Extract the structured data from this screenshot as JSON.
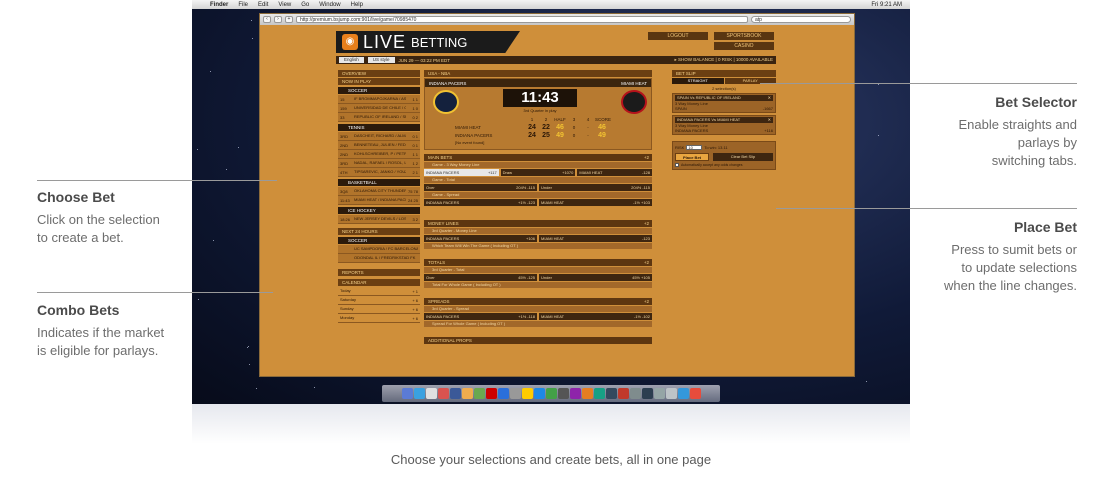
{
  "callouts": {
    "choose_bet": {
      "title": "Choose Bet",
      "line1": "Click on the selection",
      "line2": "to create a bet."
    },
    "combo_bets": {
      "title": "Combo Bets",
      "line1": "Indicates if the market",
      "line2": "is eligible for parlays."
    },
    "bet_selector": {
      "title": "Bet Selector",
      "line1": "Enable straights and",
      "line2": "parlays by",
      "line3": "switching tabs."
    },
    "place_bet": {
      "title": "Place Bet",
      "line1": "Press to sumit bets or",
      "line2": "to update selections",
      "line3": "when the line changes."
    }
  },
  "caption": "Choose your selections and create bets, all in one page",
  "menubar": {
    "app": "Finder",
    "items": [
      "File",
      "Edit",
      "View",
      "Go",
      "Window",
      "Help"
    ],
    "clock": "Fri 9:21 AM"
  },
  "browser": {
    "url": "http://premium.bsjump.com:901/live/game/70985470",
    "search": "atp"
  },
  "site": {
    "logo_live": "LIVE",
    "logo_betting": "BETTING",
    "buttons": {
      "logout": "LOGOUT",
      "sportsbook": "SPORTSBOOK",
      "casino": "CASINO"
    },
    "toolbar": {
      "language": "English",
      "odds": "US style",
      "date": "JUN 29 — 03:22 PM EDT",
      "balance": "▸ SHOW BALANCE | 0 RISK | 10000 AVAILABLE"
    }
  },
  "left": {
    "overview": "OVERVIEW",
    "now_in_play": "NOW IN PLAY",
    "soccer": "SOCCER",
    "soccer_events": [
      {
        "time": "15",
        "teams": "IF BROMMAPOJKARNA / ASSYRISKA FF",
        "s1": "1",
        "s2": "1"
      },
      {
        "time": "159",
        "teams": "UNIVERSIDAD DE CHILE / O'HIGGINS",
        "s1": "1",
        "s2": "0"
      },
      {
        "time": "33",
        "teams": "REPUBLIC OF IRELAND / SPAIN",
        "s1": "0",
        "s2": "2"
      }
    ],
    "tennis": "TENNIS",
    "tennis_events": [
      {
        "time": "3RD",
        "teams": "DASCHEIT, RICHARD / ALMAGRO, NICOLAS",
        "s1": "0",
        "s2": "1"
      },
      {
        "time": "2ND",
        "teams": "BENNETEAU, JULIEN / FEDERER, ROGER",
        "s1": "0",
        "s2": "1"
      },
      {
        "time": "2ND",
        "teams": "KOHLSCHREIBER, P / PETROVA, NADIA",
        "s1": "1",
        "s2": "1"
      },
      {
        "time": "3RD",
        "teams": "NADAL, RAFAEL / ROSOL, LUKAS",
        "s1": "1",
        "s2": "2"
      },
      {
        "time": "4TH",
        "teams": "TIPSAREVIC, JANKO / YOUZHNY, MIKHAIL",
        "s1": "2",
        "s2": "1"
      }
    ],
    "basketball": "BASKETBALL",
    "basketball_events": [
      {
        "time": "3Q8",
        "teams": "OKLAHOMA CITY THUNDER / MIAMI HEAT",
        "s1": "75",
        "s2": "78"
      },
      {
        "time": "11:43",
        "teams": "MIAMI HEAT / INDIANA PACERS",
        "s1": "24",
        "s2": "25"
      }
    ],
    "ice_hockey": "ICE HOCKEY",
    "hockey_events": [
      {
        "time": "18:26",
        "teams": "NEW JERSEY DEVILS / LOS ANGELES KINGS",
        "s1": "3",
        "s2": "2"
      }
    ],
    "next_24": "NEXT 24 HOURS",
    "soccer2": "SOCCER",
    "next_events": [
      {
        "time": "",
        "teams": "UC SAMPDORIA / FC BARCELONA 1918"
      },
      {
        "time": "",
        "teams": "ODONDAL IL / FREDRIKSTAD FK"
      }
    ],
    "reports": "REPORTS",
    "calendar": "CALENDAR",
    "calendar_days": [
      {
        "day": "Today",
        "count": "+ 1"
      },
      {
        "day": "Saturday",
        "count": "+ 6"
      },
      {
        "day": "Sunday",
        "count": "+ 6"
      },
      {
        "day": "Monday",
        "count": "+ 6"
      }
    ]
  },
  "game": {
    "league": "USA - NBA",
    "home": "INDIANA PACERS",
    "away": "MIAMI HEAT",
    "clock": "11:43",
    "period": "3rd Quarter in play",
    "headers": [
      "1",
      "2",
      "HALF",
      "3",
      "4",
      "SCORE"
    ],
    "rows": [
      {
        "team": "MIAMI HEAT",
        "q1": "24",
        "q2": "22",
        "half": "46",
        "q3": "0",
        "q4": "-",
        "score": "46"
      },
      {
        "team": "INDIANA PACERS",
        "q1": "24",
        "q2": "25",
        "half": "49",
        "q3": "0",
        "q4": "-",
        "score": "49"
      }
    ],
    "no_event": "[No event found]"
  },
  "markets": {
    "main_bets": "MAIN BETS",
    "game_money": "Game - 3 Way Money Line",
    "money_sel": [
      {
        "name": "INDIANA PACERS",
        "odds": "+117"
      },
      {
        "name": "Draw",
        "odds": "+1070"
      },
      {
        "name": "MIAMI HEAT",
        "odds": "-128"
      }
    ],
    "game_total": "Game - Total",
    "total_sel": [
      {
        "name": "Over",
        "odds": "204½ -115"
      },
      {
        "name": "Under",
        "odds": "204½ -115"
      }
    ],
    "game_spread": "Game - Spread",
    "spread_sel": [
      {
        "name": "INDIANA PACERS",
        "odds": "+1½ -123"
      },
      {
        "name": "MIAMI HEAT",
        "odds": "-1½ +103"
      }
    ],
    "money_lines": "MONEY LINES",
    "q3_money": "3rd Quarter - Money Line",
    "q3_money_sel": [
      {
        "name": "INDIANA PACERS",
        "odds": "+106"
      },
      {
        "name": "MIAMI HEAT",
        "odds": "-123"
      }
    ],
    "which_team": "Which Team Will Win The Game ( Including OT )",
    "totals": "TOTALS",
    "q3_total": "3rd Quarter - Total",
    "q3_total_sel": [
      {
        "name": "Over",
        "odds": "45½ -125"
      },
      {
        "name": "Under",
        "odds": "45½ +105"
      }
    ],
    "total_whole": "Total For Whole Game ( Including OT )",
    "spreads": "SPREADS",
    "q3_spread": "3rd Quarter - Spread",
    "q3_spread_sel": [
      {
        "name": "INDIANA PACERS",
        "odds": "+1½ -118"
      },
      {
        "name": "MIAMI HEAT",
        "odds": "-1½ -102"
      }
    ],
    "spread_whole": "Spread For Whole Game ( Including OT )",
    "additional": "ADDITIONAL PROPS"
  },
  "slip": {
    "title": "BET SLIP",
    "tab_straight": "STRAIGHT",
    "tab_parlay": "PARLAY",
    "count": "2 selection(s)",
    "items": [
      {
        "match": "SPAIN Vs REPUBLIC OF IRELAND",
        "market": "3 Way Money Line",
        "pick": "SPAIN",
        "odds": "-1667"
      },
      {
        "match": "INDIANA PACERS Vs MIAMI HEAT",
        "market": "3 Way Money Line",
        "pick": "INDIANA PACERS",
        "odds": "+116"
      }
    ],
    "risk_label": "RISK",
    "risk_value": "10",
    "to_win": "To win: 13.11",
    "place_bet": "Place Bet",
    "clear": "Clear Bet Slip",
    "auto_accept": "Automatically accept any odds changes"
  },
  "colors": {
    "accent": "#cf8f3a",
    "dark": "#2b1a0b",
    "highlight": "#e8e8e8"
  }
}
